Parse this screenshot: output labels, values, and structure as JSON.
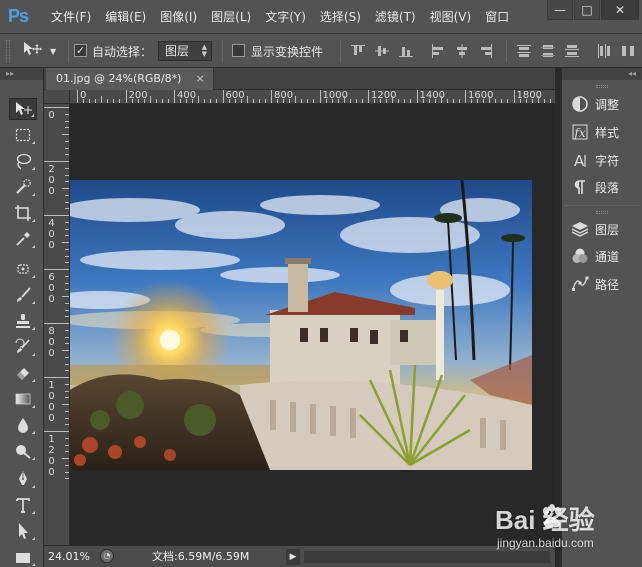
{
  "app": {
    "logo": "Ps",
    "accent": "#4ea0e6"
  },
  "menubar": {
    "items": [
      "文件(F)",
      "编辑(E)",
      "图像(I)",
      "图层(L)",
      "文字(Y)",
      "选择(S)",
      "滤镜(T)",
      "视图(V)",
      "窗口"
    ],
    "window_controls": {
      "minimize": "—",
      "restore": "□",
      "close": "✕"
    }
  },
  "options_bar": {
    "tool_icon": "move-icon",
    "auto_select_label": "自动选择：",
    "auto_select_checked": true,
    "auto_select_target": "图层",
    "show_transform_label": "显示变换控件",
    "show_transform_checked": false
  },
  "toolbox": {
    "collapse_label": "▸▸",
    "tools": [
      "move-tool",
      "marquee-tool",
      "lasso-tool",
      "quick-selection-tool",
      "crop-tool",
      "eyedropper-tool",
      "spot-healing-tool",
      "brush-tool",
      "clone-stamp-tool",
      "history-brush-tool",
      "eraser-tool",
      "gradient-tool",
      "blur-tool",
      "dodge-tool",
      "pen-tool",
      "type-tool",
      "path-selection-tool",
      "rectangle-tool"
    ]
  },
  "document": {
    "tab_title": "01.jpg @ 24%(RGB/8*)",
    "tab_close": "×",
    "ruler_top": [
      "0",
      "200",
      "400",
      "600",
      "800",
      "1000",
      "1200",
      "1400",
      "1600",
      "1800"
    ],
    "ruler_left": [
      "0",
      "2\n0\n0",
      "4\n0\n0",
      "6\n0\n0",
      "8\n0\n0",
      "1\n0\n0\n0",
      "1\n2\n0\n0"
    ],
    "image_subject": "HDR photo of a Mediterranean villa with palm trees at sunset"
  },
  "status_bar": {
    "zoom": "24.01%",
    "doc_info": "文档:6.59M/6.59M",
    "arrow": "▶"
  },
  "panels": {
    "collapse_label": "◂◂",
    "group1": [
      {
        "icon": "adjustments-icon",
        "label": "调整"
      },
      {
        "icon": "styles-icon",
        "label": "样式"
      },
      {
        "icon": "character-icon",
        "label": "字符"
      },
      {
        "icon": "paragraph-icon",
        "label": "段落"
      }
    ],
    "group2": [
      {
        "icon": "layers-icon",
        "label": "图层"
      },
      {
        "icon": "channels-icon",
        "label": "通道"
      },
      {
        "icon": "paths-icon",
        "label": "路径"
      }
    ]
  },
  "watermark": {
    "brand": "Bai   经验",
    "url": "jingyan.baidu.com"
  }
}
